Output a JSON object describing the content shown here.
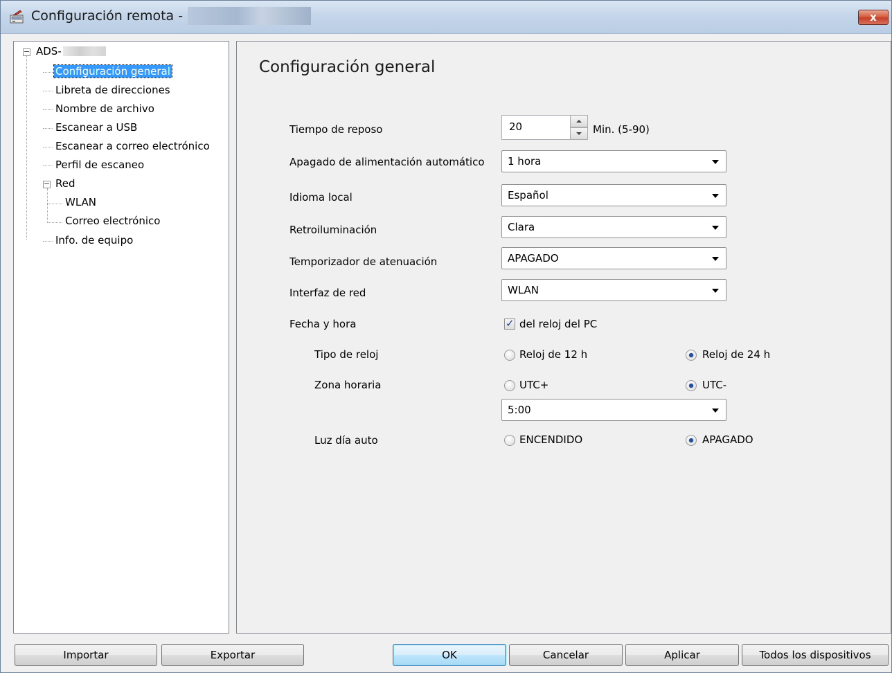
{
  "window": {
    "title": "Configuración remota -",
    "close_label": "x"
  },
  "tree": {
    "root": "ADS-",
    "items": [
      {
        "label": "Configuración general",
        "selected": true
      },
      {
        "label": "Libreta de direcciones"
      },
      {
        "label": "Nombre de archivo"
      },
      {
        "label": "Escanear a USB"
      },
      {
        "label": "Escanear a correo electrónico"
      },
      {
        "label": "Perfil de escaneo"
      },
      {
        "label": "Red"
      },
      {
        "label": "WLAN"
      },
      {
        "label": "Correo electrónico"
      },
      {
        "label": "Info. de equipo"
      }
    ]
  },
  "content": {
    "title": "Configuración general",
    "sleep": {
      "label": "Tiempo de reposo",
      "value": "20",
      "unit": "Min. (5-90)"
    },
    "auto_power_off": {
      "label": "Apagado de alimentación automático",
      "value": "1 hora"
    },
    "language": {
      "label": "Idioma local",
      "value": "Español"
    },
    "backlight": {
      "label": "Retroiluminación",
      "value": "Clara"
    },
    "dim_timer": {
      "label": "Temporizador de atenuación",
      "value": "APAGADO"
    },
    "network_interface": {
      "label": "Interfaz de red",
      "value": "WLAN"
    },
    "datetime": {
      "label": "Fecha y hora",
      "checkbox_label": "del reloj del PC",
      "checked": true
    },
    "clock_type": {
      "label": "Tipo de reloj",
      "option1": "Reloj de 12 h",
      "option2": "Reloj de 24 h",
      "selected": "option2"
    },
    "time_zone": {
      "label": "Zona horaria",
      "option1": "UTC+",
      "option2": "UTC-",
      "selected": "option2",
      "value": "5:00"
    },
    "daylight": {
      "label": "Luz día auto",
      "option1": "ENCENDIDO",
      "option2": "APAGADO",
      "selected": "option2"
    }
  },
  "buttons": {
    "import": "Importar",
    "export": "Exportar",
    "ok": "OK",
    "cancel": "Cancelar",
    "apply": "Aplicar",
    "all_devices": "Todos los dispositivos"
  }
}
